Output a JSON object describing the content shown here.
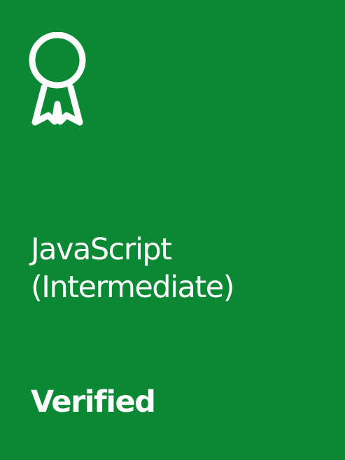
{
  "card": {
    "icon": "award-ribbon-icon",
    "title_line1": "JavaScript",
    "title_line2": "(Intermediate)",
    "status": "Verified"
  },
  "colors": {
    "background": "#0a8833",
    "foreground": "#ffffff"
  }
}
